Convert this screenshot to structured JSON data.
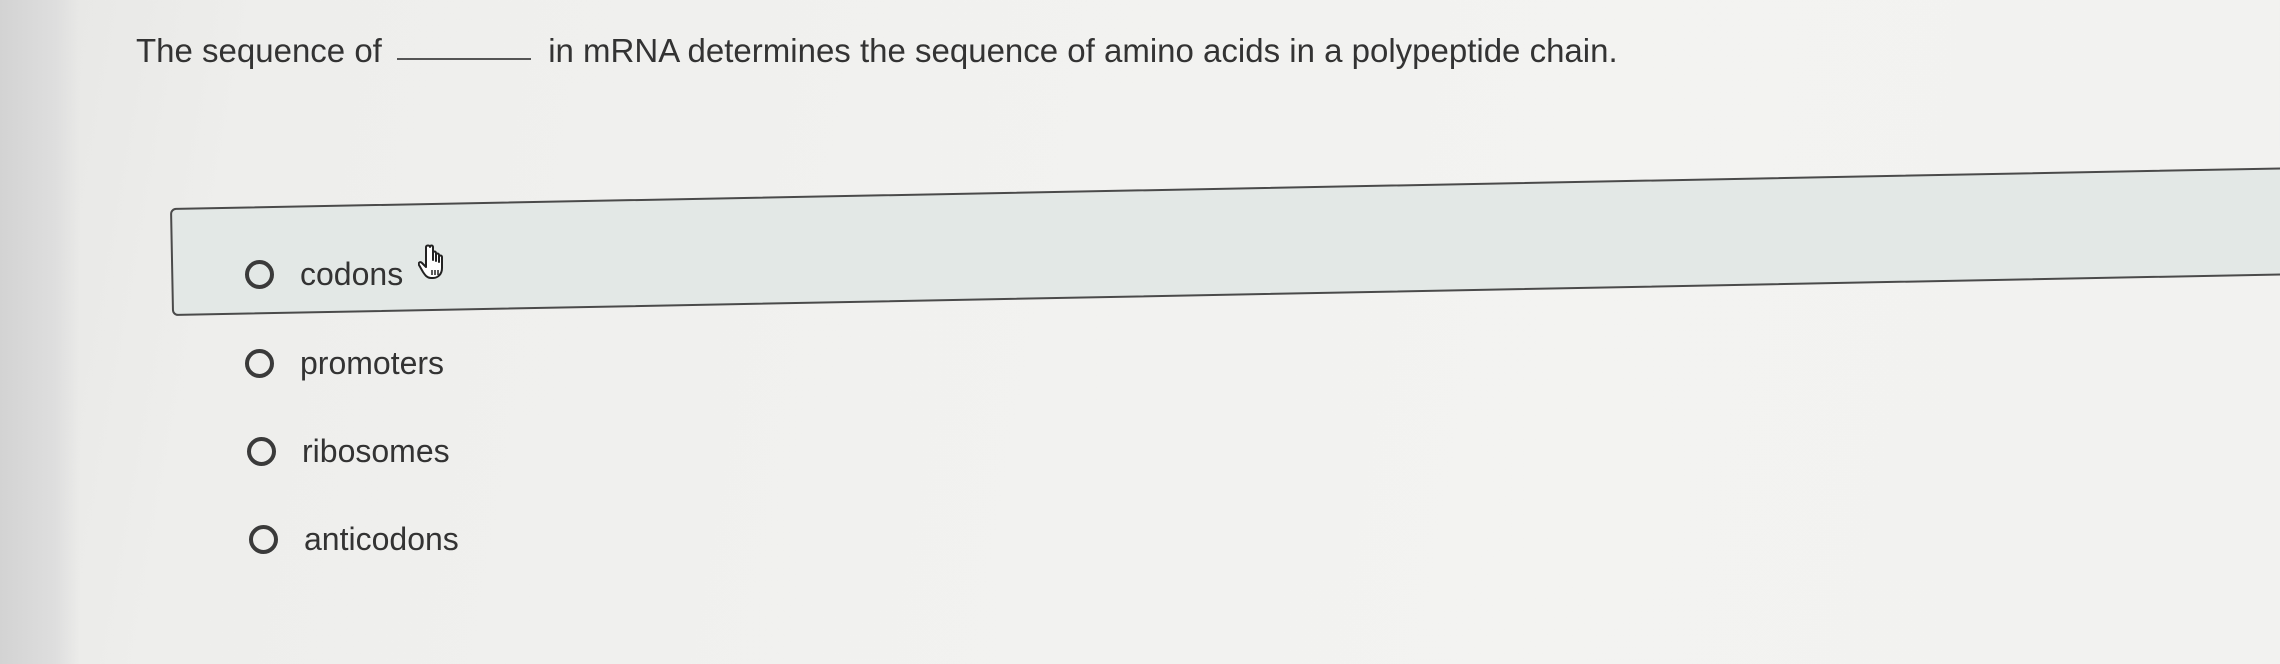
{
  "question": {
    "prefix": "The sequence of",
    "suffix": "in mRNA determines the sequence of amino acids in a polypeptide chain."
  },
  "options": [
    {
      "label": "codons"
    },
    {
      "label": "promoters"
    },
    {
      "label": "ribosomes"
    },
    {
      "label": "anticodons"
    }
  ],
  "hover_option_index": 0,
  "icons": {
    "radio": "radio-circle-icon",
    "cursor": "hand-pointer-icon"
  }
}
